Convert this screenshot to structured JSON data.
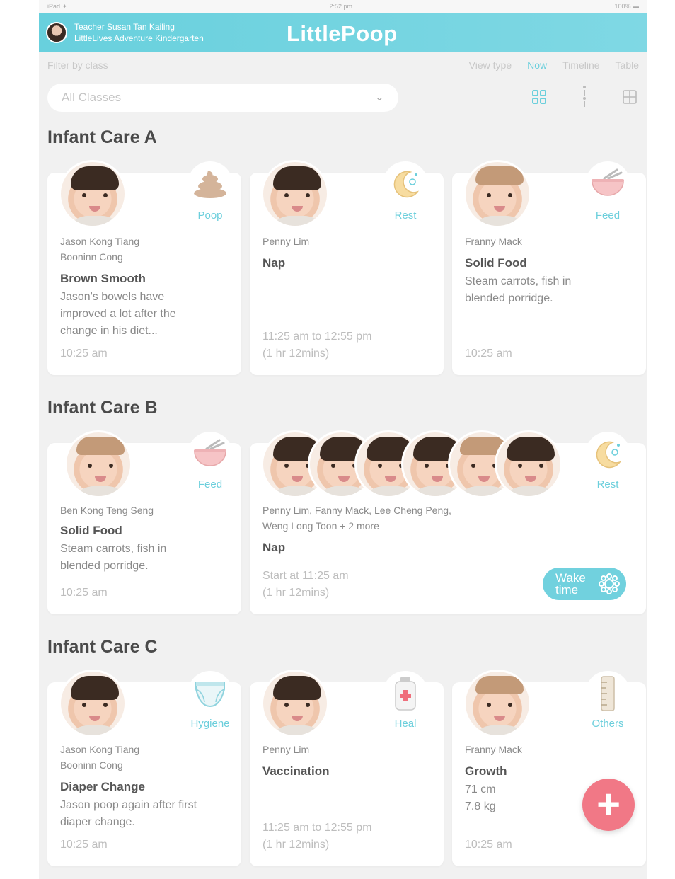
{
  "status_bar": {
    "left": "iPad ✦",
    "center": "2:52 pm",
    "right": "100% ▬"
  },
  "header": {
    "teacher_name": "Teacher Susan Tan Kailing",
    "school": "LittleLives Adventure Kindergarten",
    "app_title": "LittlePoop",
    "brand_color": "#6ccfdc"
  },
  "filter": {
    "label": "Filter by class",
    "selected": "All Classes"
  },
  "view_type": {
    "label": "View type",
    "options": [
      "Now",
      "Timeline",
      "Table"
    ],
    "active": "Now"
  },
  "sections": [
    {
      "title": "Infant Care A",
      "cards": [
        {
          "names": [
            "Jason Kong Tiang",
            "Booninn Cong"
          ],
          "category": "Poop",
          "category_icon": "poop-icon",
          "title": "Brown Smooth",
          "desc": [
            "Jason's bowels have",
            "improved a lot after the",
            "change in his diet..."
          ],
          "time": [
            "10:25 am"
          ]
        },
        {
          "names": [
            "Penny Lim"
          ],
          "category": "Rest",
          "category_icon": "moon-icon",
          "title": "Nap",
          "desc": [],
          "time": [
            "11:25 am to 12:55 pm",
            "(1 hr 12mins)"
          ]
        },
        {
          "names": [
            "Franny Mack"
          ],
          "category": "Feed",
          "category_icon": "bowl-icon",
          "title": "Solid Food",
          "desc": [
            "Steam carrots, fish in",
            "blended porridge."
          ],
          "time": [
            "10:25 am"
          ]
        }
      ]
    },
    {
      "title": "Infant Care B",
      "cards": [
        {
          "names": [
            "Ben Kong Teng Seng"
          ],
          "category": "Feed",
          "category_icon": "bowl-icon",
          "title": "Solid Food",
          "desc": [
            "Steam carrots, fish in",
            "blended porridge."
          ],
          "time": [
            "10:25 am"
          ]
        },
        {
          "names": [
            "Penny Lim, Fanny Mack, Lee Cheng Peng,",
            "Weng Long Toon + 2 more"
          ],
          "category": "Rest",
          "category_icon": "moon-icon",
          "title": "Nap",
          "desc": [],
          "time": [
            "Start at 11:25 am",
            "(1 hr 12mins)"
          ],
          "action": [
            "Wake",
            "time"
          ]
        }
      ]
    },
    {
      "title": "Infant Care C",
      "cards": [
        {
          "names": [
            "Jason Kong Tiang",
            "Booninn Cong"
          ],
          "category": "Hygiene",
          "category_icon": "diaper-icon",
          "title": "Diaper Change",
          "desc": [
            "Jason poop again after first",
            "diaper change."
          ],
          "time": [
            "10:25 am"
          ]
        },
        {
          "names": [
            "Penny Lim"
          ],
          "category": "Heal",
          "category_icon": "medicine-bottle-icon",
          "title": "Vaccination",
          "desc": [],
          "time": [
            "11:25 am to 12:55 pm",
            "(1 hr 12mins)"
          ]
        },
        {
          "names": [
            "Franny Mack"
          ],
          "category": "Others",
          "category_icon": "ruler-icon",
          "title": "Growth",
          "desc": [
            "71 cm",
            "7.8 kg"
          ],
          "time": [
            "10:25 am"
          ]
        }
      ]
    }
  ],
  "fab": {
    "label": "+"
  }
}
